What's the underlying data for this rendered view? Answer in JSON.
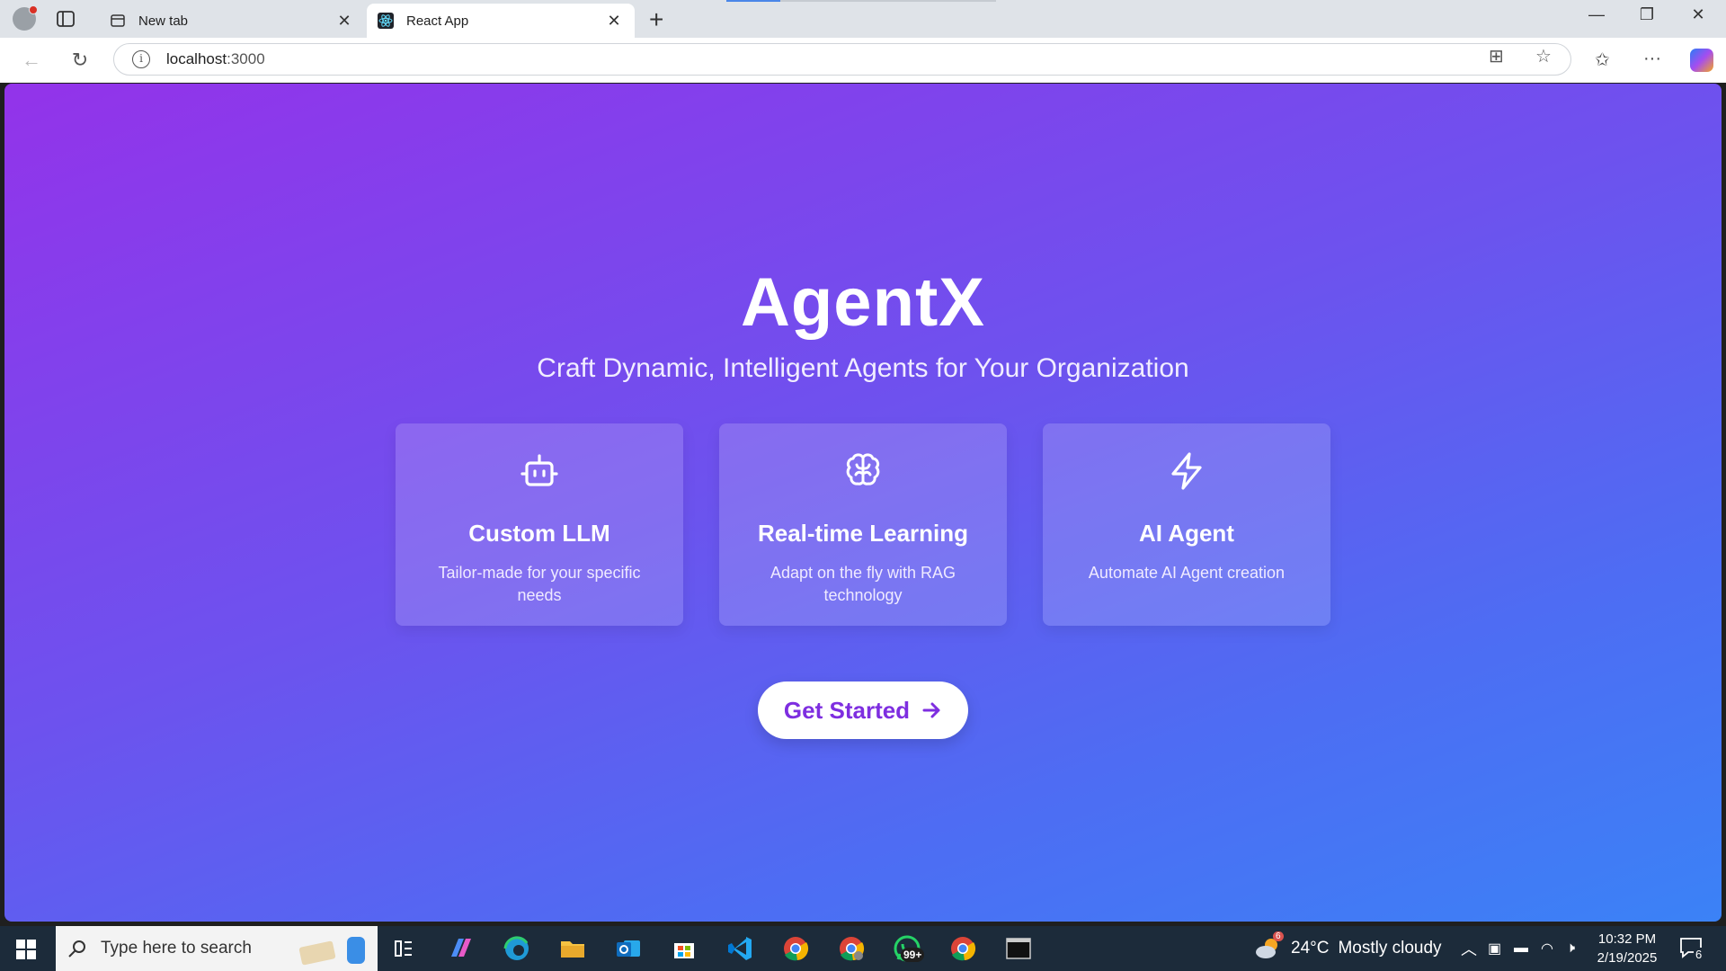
{
  "browser": {
    "tabs": [
      {
        "label": "New tab",
        "active": false
      },
      {
        "label": "React App",
        "active": true
      }
    ],
    "address": {
      "host": "localhost",
      "port": ":3000"
    }
  },
  "page": {
    "title": "AgentX",
    "subtitle": "Craft Dynamic, Intelligent Agents for Your Organization",
    "cards": [
      {
        "icon": "robot-icon",
        "title": "Custom LLM",
        "description": "Tailor-made for your specific needs"
      },
      {
        "icon": "brain-icon",
        "title": "Real-time Learning",
        "description": "Adapt on the fly with RAG technology"
      },
      {
        "icon": "lightning-icon",
        "title": "AI Agent",
        "description": "Automate AI Agent creation"
      }
    ],
    "cta": {
      "label": "Get Started"
    }
  },
  "taskbar": {
    "search_placeholder": "Type here to search",
    "whatsapp_badge": "99+",
    "weather": {
      "temp": "24°C",
      "condition": "Mostly cloudy",
      "alert_count": "6"
    },
    "clock": {
      "time": "10:32 PM",
      "date": "2/19/2025"
    },
    "notification_count": "6"
  },
  "colors": {
    "gradient_start": "#9333ea",
    "gradient_end": "#3b82f6",
    "cta_text": "#7e2ee0"
  }
}
